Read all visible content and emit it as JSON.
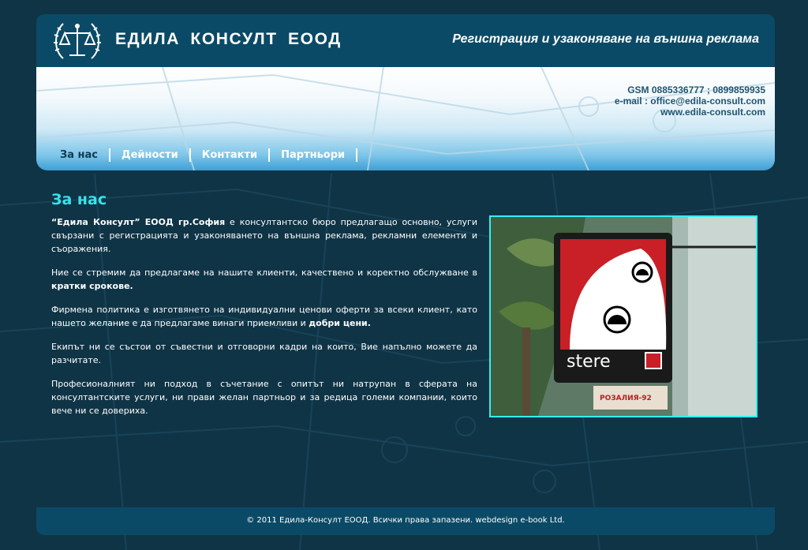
{
  "header": {
    "company_name": "ЕДИЛА  КОНСУЛТ  ЕООД",
    "tagline": "Регистрация и узаконяване на външна реклама",
    "logo_icon": "scales-laurel-icon"
  },
  "contact": {
    "gsm": "GSM 0885336777 ; 0899859935",
    "email": "e-mail : office@edila-consult.com",
    "web": "www.edila-consult.com"
  },
  "nav": {
    "items": [
      {
        "label": "За нас",
        "active": true
      },
      {
        "label": "Дейности"
      },
      {
        "label": "Контакти"
      },
      {
        "label": "Партньори"
      }
    ]
  },
  "main": {
    "title": "За нас",
    "p1_bold": "“Едила Консулт” ЕООД гр.София",
    "p1_rest": " е консултантско бюро предлагащо основно, услуги свързани с регистрацията и узаконяването на външна реклама, рекламни елементи и съоражения.",
    "p2_text": "Ние се стремим да предлагаме на нашите клиенти, качествено и коректно обслужване в ",
    "p2_bold": "кратки срокове.",
    "p3_text": "Фирмена политика е изготвянето на индивидуални ценови оферти за всеки клиент, като нашето желание е да предлагаме винаги приемливи и ",
    "p3_bold": "добри цени.",
    "p4": "Екипът ни се състои от съвестни и отговорни кадри на които, Вие напълно можете да разчитате.",
    "p5": "Професионалният ни подход в съчетание с опитът ни натрупан в сферата на консултантските услуги, ни прави желан партньор и за редица големи компании, които вече ни се довериха."
  },
  "photo": {
    "sign_text": "stere",
    "sub_sign": "РОЗАЛИЯ-92"
  },
  "colors": {
    "background": "#0f3446",
    "header_bar": "#0b4a66",
    "accent_title": "#36e3ee",
    "photo_border": "#2ff0f5"
  },
  "footer": {
    "text": "© 2011 Едила-Консулт ЕООД. Всички права запазени. webdesign e-book Ltd."
  }
}
